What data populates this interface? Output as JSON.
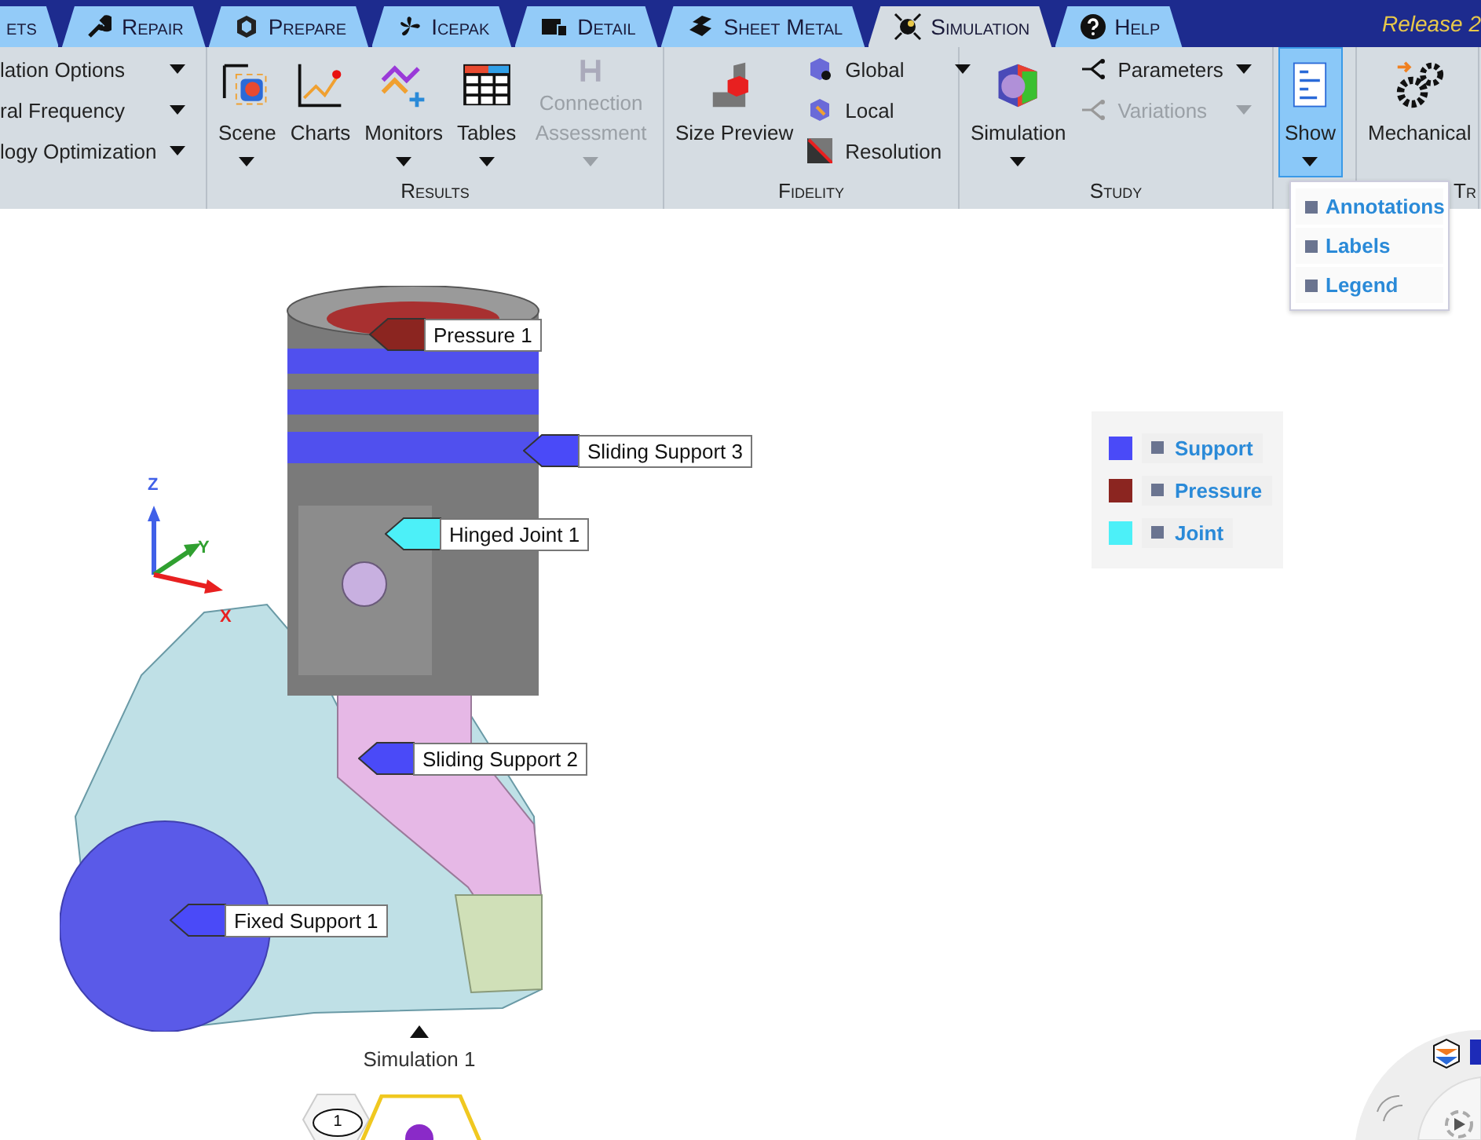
{
  "tabs": [
    {
      "label": "ets",
      "selected": false
    },
    {
      "label": "Repair",
      "selected": false
    },
    {
      "label": "Prepare",
      "selected": false
    },
    {
      "label": "Icepak",
      "selected": false
    },
    {
      "label": "Detail",
      "selected": false
    },
    {
      "label": "Sheet Metal",
      "selected": false
    },
    {
      "label": "Simulation",
      "selected": true
    },
    {
      "label": "Help",
      "selected": false
    }
  ],
  "release": "Release 2",
  "ribbon": {
    "groups": [
      {
        "items": [
          {
            "kind": "stack",
            "entries": [
              {
                "label": "lation Options",
                "menu": true,
                "disabled": false
              },
              {
                "label": "ral Frequency",
                "menu": true,
                "disabled": false
              },
              {
                "label": "logy Optimization",
                "menu": true,
                "disabled": false
              }
            ]
          }
        ]
      },
      {
        "title": "Results",
        "items": [
          {
            "kind": "large",
            "label": "Scene",
            "menu": true,
            "disabled": false,
            "active": false
          },
          {
            "kind": "large",
            "label": "Charts",
            "menu": false,
            "disabled": false,
            "active": false
          },
          {
            "kind": "large",
            "label": "Monitors",
            "menu": true,
            "disabled": false,
            "active": false
          },
          {
            "kind": "large",
            "label": "Tables",
            "menu": true,
            "disabled": false,
            "active": false
          },
          {
            "kind": "large",
            "label": "Connection Assessment",
            "menu": true,
            "disabled": true,
            "active": false
          }
        ]
      },
      {
        "title": "Fidelity",
        "items": [
          {
            "kind": "large",
            "label": "Size Preview",
            "menu": false,
            "disabled": false,
            "active": false
          },
          {
            "kind": "stack",
            "entries": [
              {
                "label": "Global",
                "menu": true,
                "disabled": false
              },
              {
                "label": "Local",
                "menu": false,
                "disabled": false
              },
              {
                "label": "Resolution",
                "menu": false,
                "disabled": false
              }
            ]
          }
        ]
      },
      {
        "title": "Study",
        "items": [
          {
            "kind": "large",
            "label": "Simulation",
            "menu": true,
            "disabled": false,
            "active": false
          },
          {
            "kind": "stack",
            "entries": [
              {
                "label": "Parameters",
                "menu": true,
                "disabled": false
              },
              {
                "label": "Variations",
                "menu": true,
                "disabled": true
              }
            ]
          }
        ]
      },
      {
        "items": [
          {
            "kind": "large",
            "label": "Show",
            "menu": true,
            "disabled": false,
            "active": true
          }
        ]
      },
      {
        "title": "Tr",
        "items": [
          {
            "kind": "large",
            "label": "Mechanical",
            "menu": false,
            "disabled": false,
            "active": false
          }
        ]
      }
    ]
  },
  "show_menu": [
    "Annotations",
    "Labels",
    "Legend"
  ],
  "axes": [
    {
      "label": "Z"
    },
    {
      "label": "Y"
    },
    {
      "label": "X"
    }
  ],
  "callouts": [
    {
      "label": "Pressure 1",
      "color": "#8b2520"
    },
    {
      "label": "Sliding Support 3",
      "color": "#4a4af8"
    },
    {
      "label": "Hinged Joint 1",
      "color": "#4cf0f8"
    },
    {
      "label": "Sliding Support 2",
      "color": "#4a4af8"
    },
    {
      "label": "Fixed Support 1",
      "color": "#4a4af8"
    }
  ],
  "legend": [
    {
      "label": "Support",
      "color": "#4a4af8"
    },
    {
      "label": "Pressure",
      "color": "#8b2520"
    },
    {
      "label": "Joint",
      "color": "#4cf0f8"
    }
  ],
  "tree": {
    "label": "Simulation 1",
    "badge": "1"
  }
}
